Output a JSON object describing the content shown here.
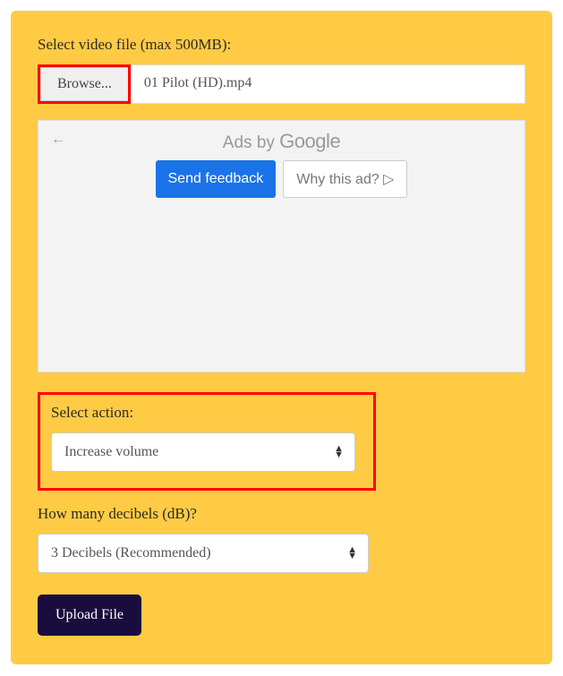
{
  "fileSection": {
    "label": "Select video file (max 500MB):",
    "browseLabel": "Browse...",
    "fileName": "01 Pilot (HD).mp4"
  },
  "ad": {
    "titlePrefix": "Ads by ",
    "back": "←",
    "feedback": "Send feedback",
    "whyAd": "Why this ad? ▷"
  },
  "actionSection": {
    "label": "Select action:",
    "selected": "Increase volume"
  },
  "decibelSection": {
    "label": "How many decibels (dB)?",
    "selected": "3 Decibels (Recommended)"
  },
  "uploadLabel": "Upload File"
}
